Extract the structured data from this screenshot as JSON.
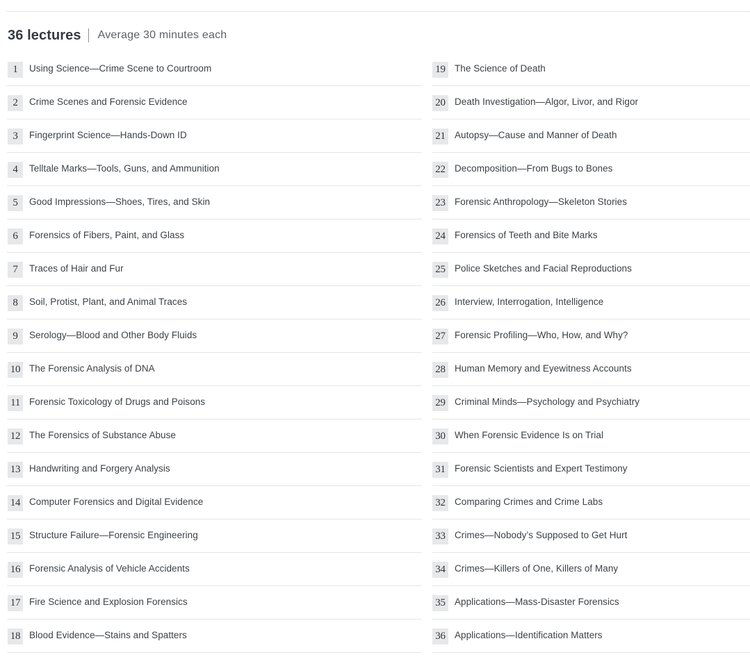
{
  "header": {
    "count": "36 lectures",
    "average": "Average 30 minutes each"
  },
  "lectures_left": [
    {
      "number": "1",
      "title": "Using Science—Crime Scene to Courtroom"
    },
    {
      "number": "2",
      "title": "Crime Scenes and Forensic Evidence"
    },
    {
      "number": "3",
      "title": "Fingerprint Science—Hands-Down ID"
    },
    {
      "number": "4",
      "title": "Telltale Marks—Tools, Guns, and Ammunition"
    },
    {
      "number": "5",
      "title": "Good Impressions—Shoes, Tires, and Skin"
    },
    {
      "number": "6",
      "title": "Forensics of Fibers, Paint, and Glass"
    },
    {
      "number": "7",
      "title": "Traces of Hair and Fur"
    },
    {
      "number": "8",
      "title": "Soil, Protist, Plant, and Animal Traces"
    },
    {
      "number": "9",
      "title": "Serology—Blood and Other Body Fluids"
    },
    {
      "number": "10",
      "title": "The Forensic Analysis of DNA"
    },
    {
      "number": "11",
      "title": "Forensic Toxicology of Drugs and Poisons"
    },
    {
      "number": "12",
      "title": "The Forensics of Substance Abuse"
    },
    {
      "number": "13",
      "title": "Handwriting and Forgery Analysis"
    },
    {
      "number": "14",
      "title": "Computer Forensics and Digital Evidence"
    },
    {
      "number": "15",
      "title": "Structure Failure—Forensic Engineering"
    },
    {
      "number": "16",
      "title": "Forensic Analysis of Vehicle Accidents"
    },
    {
      "number": "17",
      "title": "Fire Science and Explosion Forensics"
    },
    {
      "number": "18",
      "title": "Blood Evidence—Stains and Spatters"
    }
  ],
  "lectures_right": [
    {
      "number": "19",
      "title": "The Science of Death"
    },
    {
      "number": "20",
      "title": "Death Investigation—Algor, Livor, and Rigor"
    },
    {
      "number": "21",
      "title": "Autopsy—Cause and Manner of Death"
    },
    {
      "number": "22",
      "title": "Decomposition—From Bugs to Bones"
    },
    {
      "number": "23",
      "title": "Forensic Anthropology—Skeleton Stories"
    },
    {
      "number": "24",
      "title": "Forensics of Teeth and Bite Marks"
    },
    {
      "number": "25",
      "title": "Police Sketches and Facial Reproductions"
    },
    {
      "number": "26",
      "title": "Interview, Interrogation, Intelligence"
    },
    {
      "number": "27",
      "title": "Forensic Profiling—Who, How, and Why?"
    },
    {
      "number": "28",
      "title": "Human Memory and Eyewitness Accounts"
    },
    {
      "number": "29",
      "title": "Criminal Minds—Psychology and Psychiatry"
    },
    {
      "number": "30",
      "title": "When Forensic Evidence Is on Trial"
    },
    {
      "number": "31",
      "title": "Forensic Scientists and Expert Testimony"
    },
    {
      "number": "32",
      "title": "Comparing Crimes and Crime Labs"
    },
    {
      "number": "33",
      "title": "Crimes—Nobody’s Supposed to Get Hurt"
    },
    {
      "number": "34",
      "title": "Crimes—Killers of One, Killers of Many"
    },
    {
      "number": "35",
      "title": "Applications—Mass-Disaster Forensics"
    },
    {
      "number": "36",
      "title": "Applications—Identification Matters"
    }
  ]
}
